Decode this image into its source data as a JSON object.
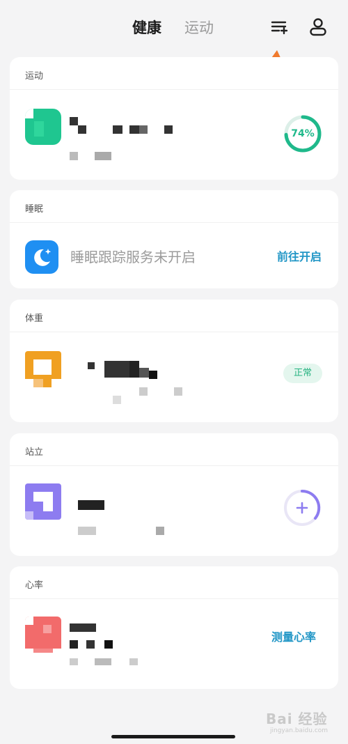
{
  "header": {
    "tabs": [
      {
        "label": "健康",
        "active": true
      },
      {
        "label": "运动",
        "active": false
      }
    ],
    "icons": [
      "list-add-icon",
      "profile-icon"
    ]
  },
  "cards": {
    "sport": {
      "title": "运动",
      "progress_text": "74%",
      "progress": 0.74
    },
    "sleep": {
      "title": "睡眠",
      "message": "睡眠跟踪服务未开启",
      "action": "前往开启"
    },
    "weight": {
      "title": "体重",
      "status": "正常"
    },
    "stand": {
      "title": "站立"
    },
    "heart": {
      "title": "心率",
      "action": "测量心率"
    }
  },
  "watermark": {
    "top": "Bai 经验",
    "bottom": "jingyan.baidu.com"
  },
  "colors": {
    "accent_green": "#1fb98b",
    "link_blue": "#2196c6",
    "sleep_blue": "#1f8ff2",
    "weight_orange": "#f0a022",
    "stand_purple": "#8d7cf0",
    "heart_red": "#f26b6b",
    "arrow_orange": "#f07a2d"
  }
}
